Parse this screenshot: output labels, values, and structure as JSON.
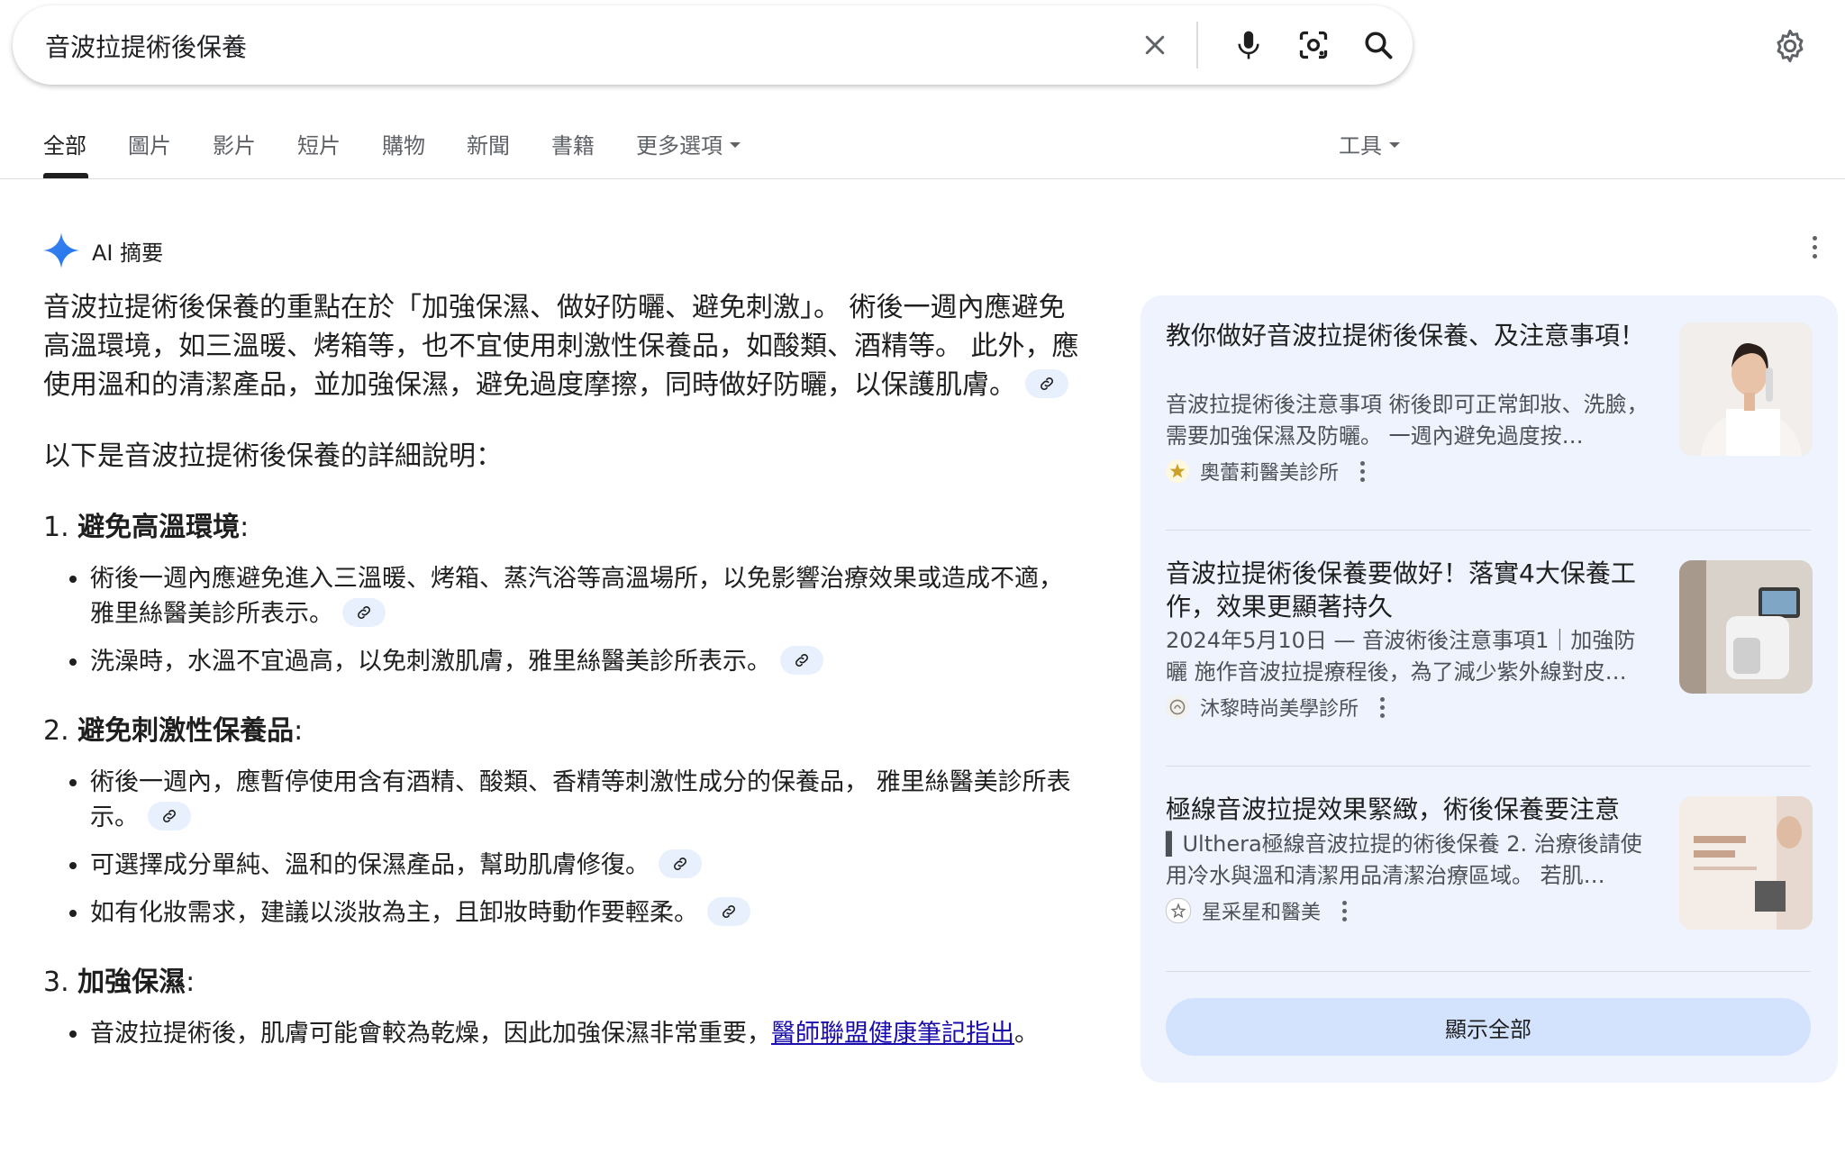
{
  "search": {
    "query": "音波拉提術後保養",
    "clear_icon": "close-icon",
    "voice_icon": "mic-icon",
    "lens_icon": "camera-lens-icon",
    "search_icon": "search-icon",
    "settings_icon": "gear-icon"
  },
  "tabs": [
    {
      "label": "全部",
      "active": true
    },
    {
      "label": "圖片"
    },
    {
      "label": "影片"
    },
    {
      "label": "短片"
    },
    {
      "label": "購物"
    },
    {
      "label": "新聞"
    },
    {
      "label": "書籍"
    },
    {
      "label": "更多選項"
    }
  ],
  "tools_label": "工具",
  "ai_overview": {
    "title": "AI 摘要",
    "summary": "音波拉提術後保養的重點在於「加強保濕、做好防曬、避免刺激」。 術後一週內應避免高溫環境，如三溫暖、烤箱等，也不宜使用刺激性保養品，如酸類、酒精等。 此外，應使用溫和的清潔產品，並加強保濕，避免過度摩擦，同時做好防曬，以保護肌膚。",
    "intro": "以下是音波拉提術後保養的詳細說明：",
    "sections": [
      {
        "num": "1.",
        "heading": "避免高溫環境",
        "colon": ":",
        "items": [
          "術後一週內應避免進入三溫暖、烤箱、蒸汽浴等高溫場所，以免影響治療效果或造成不適，雅里絲醫美診所表示。",
          "洗澡時，水溫不宜過高，以免刺激肌膚，雅里絲醫美診所表示。"
        ]
      },
      {
        "num": "2.",
        "heading": "避免刺激性保養品",
        "colon": ":",
        "items": [
          "術後一週內，應暫停使用含有酒精、酸類、香精等刺激性成分的保養品， 雅里絲醫美診所表示。",
          "可選擇成分單純、溫和的保濕產品，幫助肌膚修復。",
          "如有化妝需求，建議以淡妝為主，且卸妝時動作要輕柔。"
        ]
      },
      {
        "num": "3.",
        "heading": "加強保濕",
        "colon": ":",
        "items_with_link": {
          "text": "音波拉提術後，肌膚可能會較為乾燥，因此加強保濕非常重要，",
          "link": "醫師聯盟健康筆記指出",
          "after": "。"
        }
      }
    ]
  },
  "sources": [
    {
      "title": "教你做好音波拉提術後保養、及注意事項！",
      "snippet": "音波拉提術後注意事項 術後即可正常卸妝、洗臉，需要加強保濕及防曬。 一週內避免過度按…",
      "source": "奧蕾莉醫美診所"
    },
    {
      "title": "音波拉提術後保養要做好！落實4大保養工作，效果更顯著持久",
      "snippet": "2024年5月10日 — 音波術後注意事項1｜加強防曬 施作音波拉提療程後，為了減少紫外線對皮…",
      "source": "沐黎時尚美學診所"
    },
    {
      "title": "極線音波拉提效果緊緻，術後保養要注意",
      "snippet": "▍Ulthera極線音波拉提的術後保養 2. 治療後請使用冷水與溫和清潔用品清潔治療區域。 若肌…",
      "source": "星采星和醫美"
    }
  ],
  "show_all": "顯示全部",
  "colors": {
    "link": "#1a0dab",
    "panel_bg": "#eef3fd",
    "chip_bg": "#e8f0fe",
    "button_bg": "#d3e3fd"
  }
}
